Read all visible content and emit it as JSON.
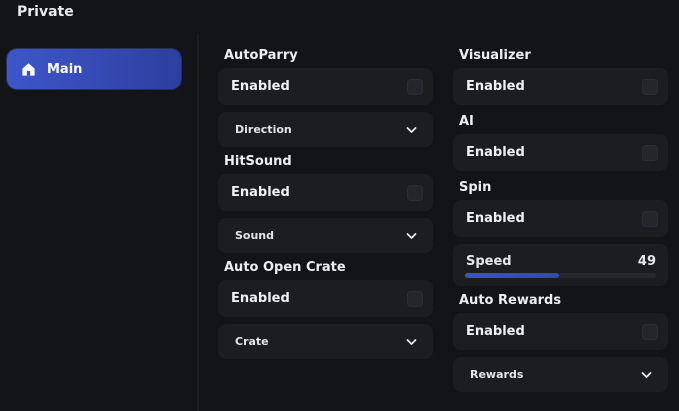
{
  "window": {
    "title": "Private"
  },
  "sidebar": {
    "items": [
      {
        "label": "Main",
        "icon": "home-icon",
        "active": true
      }
    ],
    "active_color": "#3e56cb"
  },
  "left_column": {
    "autoparry": {
      "title": "AutoParry",
      "toggle_label": "Enabled",
      "dropdown_label": "Direction"
    },
    "hitsound": {
      "title": "HitSound",
      "toggle_label": "Enabled",
      "dropdown_label": "Sound"
    },
    "auto_open_crate": {
      "title": "Auto Open Crate",
      "toggle_label": "Enabled",
      "dropdown_label": "Crate"
    }
  },
  "right_column": {
    "visualizer": {
      "title": "Visualizer",
      "toggle_label": "Enabled"
    },
    "ai": {
      "title": "AI",
      "toggle_label": "Enabled"
    },
    "spin": {
      "title": "Spin",
      "toggle_label": "Enabled",
      "speed_label": "Speed",
      "speed_value": "49",
      "speed_fraction": 0.49
    },
    "auto_rewards": {
      "title": "Auto Rewards",
      "toggle_label": "Enabled",
      "dropdown_label": "Rewards"
    }
  },
  "colors": {
    "background": "#131417",
    "panel": "#1c1d21",
    "accent": "#3e56cb"
  }
}
